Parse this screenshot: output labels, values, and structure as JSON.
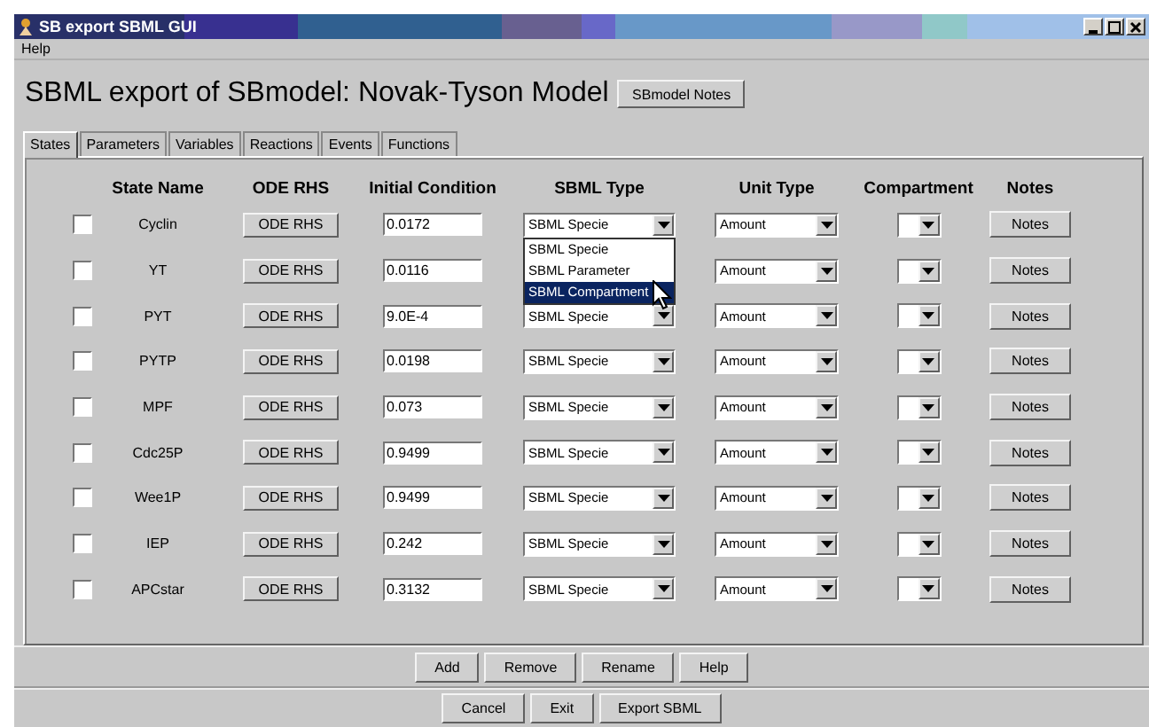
{
  "window": {
    "title": "SB export SBML GUI"
  },
  "menu": [
    "Help"
  ],
  "heading": "SBML export of SBmodel: Novak-Tyson Model",
  "notes_button": "SBmodel Notes",
  "tabs": [
    {
      "label": "States",
      "selected": true
    },
    {
      "label": "Parameters",
      "selected": false
    },
    {
      "label": "Variables",
      "selected": false
    },
    {
      "label": "Reactions",
      "selected": false
    },
    {
      "label": "Events",
      "selected": false
    },
    {
      "label": "Functions",
      "selected": false
    }
  ],
  "table": {
    "columns": [
      "State Name",
      "ODE RHS",
      "Initial Condition",
      "SBML Type",
      "Unit Type",
      "Compartment",
      "Notes"
    ],
    "rows": [
      {
        "checked": false,
        "name": "Cyclin",
        "ode": "ODE RHS",
        "initial": "0.0172",
        "sbml_type": "SBML Specie",
        "unit": "Amount",
        "notes": "Notes",
        "dropdown": {
          "options": [
            {
              "label": "SBML Specie",
              "selected": false
            },
            {
              "label": "SBML Parameter",
              "selected": false
            },
            {
              "label": "SBML Compartment",
              "selected": true
            }
          ]
        }
      },
      {
        "checked": false,
        "name": "YT",
        "ode": "ODE RHS",
        "initial": "0.0116",
        "unit": "Amount",
        "notes": "Notes"
      },
      {
        "checked": false,
        "name": "PYT",
        "ode": "ODE RHS",
        "initial": "9.0E-4",
        "sbml_type": "SBML Specie",
        "unit": "Amount",
        "notes": "Notes"
      },
      {
        "checked": false,
        "name": "PYTP",
        "ode": "ODE RHS",
        "initial": "0.0198",
        "sbml_type": "SBML Specie",
        "unit": "Amount",
        "notes": "Notes"
      },
      {
        "checked": false,
        "name": "MPF",
        "ode": "ODE RHS",
        "initial": "0.073",
        "sbml_type": "SBML Specie",
        "unit": "Amount",
        "notes": "Notes"
      },
      {
        "checked": false,
        "name": "Cdc25P",
        "ode": "ODE RHS",
        "initial": "0.9499",
        "sbml_type": "SBML Specie",
        "unit": "Amount",
        "notes": "Notes"
      },
      {
        "checked": false,
        "name": "Wee1P",
        "ode": "ODE RHS",
        "initial": "0.9499",
        "sbml_type": "SBML Specie",
        "unit": "Amount",
        "notes": "Notes"
      },
      {
        "checked": false,
        "name": "IEP",
        "ode": "ODE RHS",
        "initial": "0.242",
        "sbml_type": "SBML Specie",
        "unit": "Amount",
        "notes": "Notes"
      },
      {
        "checked": false,
        "name": "APCstar",
        "ode": "ODE RHS",
        "initial": "0.3132",
        "sbml_type": "SBML Specie",
        "unit": "Amount",
        "notes": "Notes"
      }
    ]
  },
  "edit_buttons": [
    "Add",
    "Remove",
    "Rename",
    "Help"
  ],
  "footer_buttons": [
    "Cancel",
    "Exit",
    "Export SBML"
  ]
}
